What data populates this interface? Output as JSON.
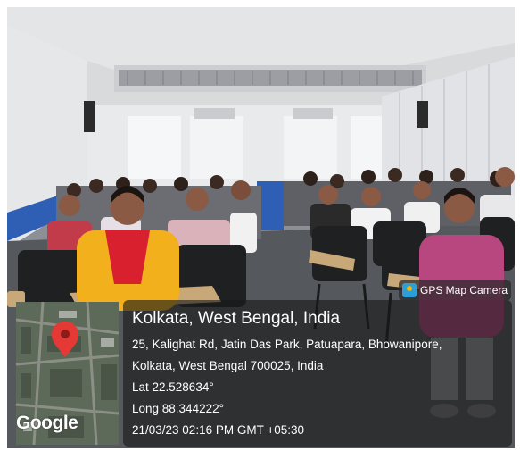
{
  "camera_badge": {
    "label": "GPS Map Camera",
    "icon": "gps-map-camera-icon"
  },
  "location": {
    "title": "Kolkata, West Bengal, India",
    "address_line1": "25, Kalighat Rd, Jatin Das Park, Patuapara, Bhowanipore,",
    "address_line2": "Kolkata, West Bengal 700025, India",
    "lat": "Lat 22.528634°",
    "long": "Long 88.344222°",
    "timestamp": "21/03/23 02:16 PM GMT +05:30"
  },
  "map": {
    "watermark": "Google",
    "pin_color": "#e53935"
  },
  "colors": {
    "overlay_bg": "#1a1a1a",
    "overlay_text": "#ffffff",
    "wall_blue": "#2f5fb4"
  }
}
